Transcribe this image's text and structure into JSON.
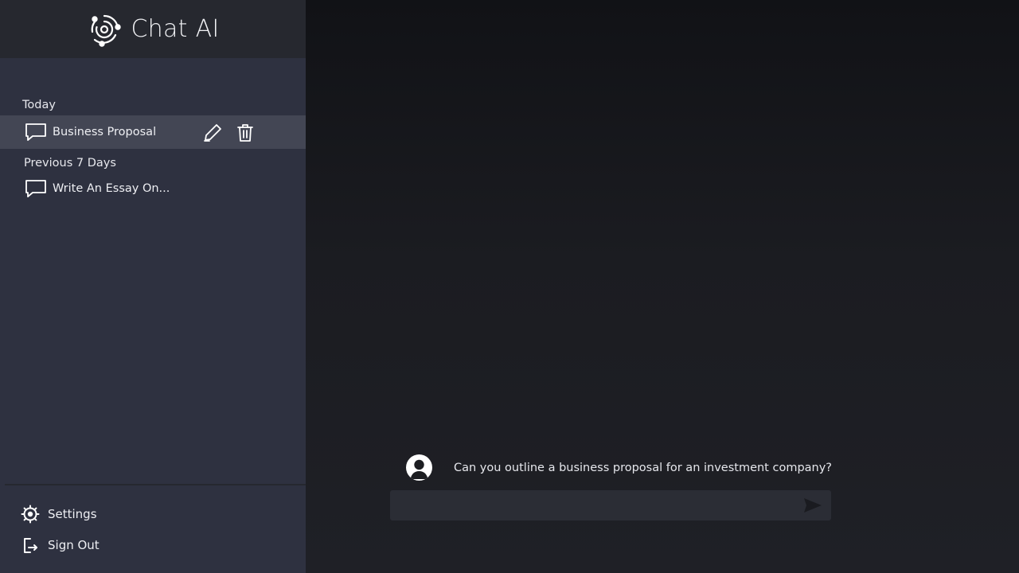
{
  "app": {
    "title": "Chat AI"
  },
  "sidebar": {
    "sections": [
      {
        "label": "Today"
      },
      {
        "label": "Previous 7 Days"
      }
    ],
    "chats": [
      {
        "title": "Business Proposal",
        "active": true
      },
      {
        "title": "Write An Essay On..."
      }
    ],
    "footer": {
      "settings_label": "Settings",
      "signout_label": "Sign Out"
    }
  },
  "conversation": {
    "messages": [
      {
        "role": "user",
        "text": "Can you outline a business proposal for an investment company?"
      }
    ]
  },
  "composer": {
    "value": "",
    "placeholder": ""
  },
  "icons": {
    "logo": "ai-logo-icon",
    "chat": "chat-bubble-icon",
    "edit": "pencil-icon",
    "delete": "trash-icon",
    "settings": "gear-icon",
    "signout": "sign-out-icon",
    "avatar": "user-avatar-icon",
    "send": "send-icon"
  },
  "colors": {
    "sidebar_bg": "#2e3140",
    "brand_bg": "#26282f",
    "active_row": "#434654",
    "composer_bg": "#2b2d35",
    "text": "#e8e9ee"
  }
}
